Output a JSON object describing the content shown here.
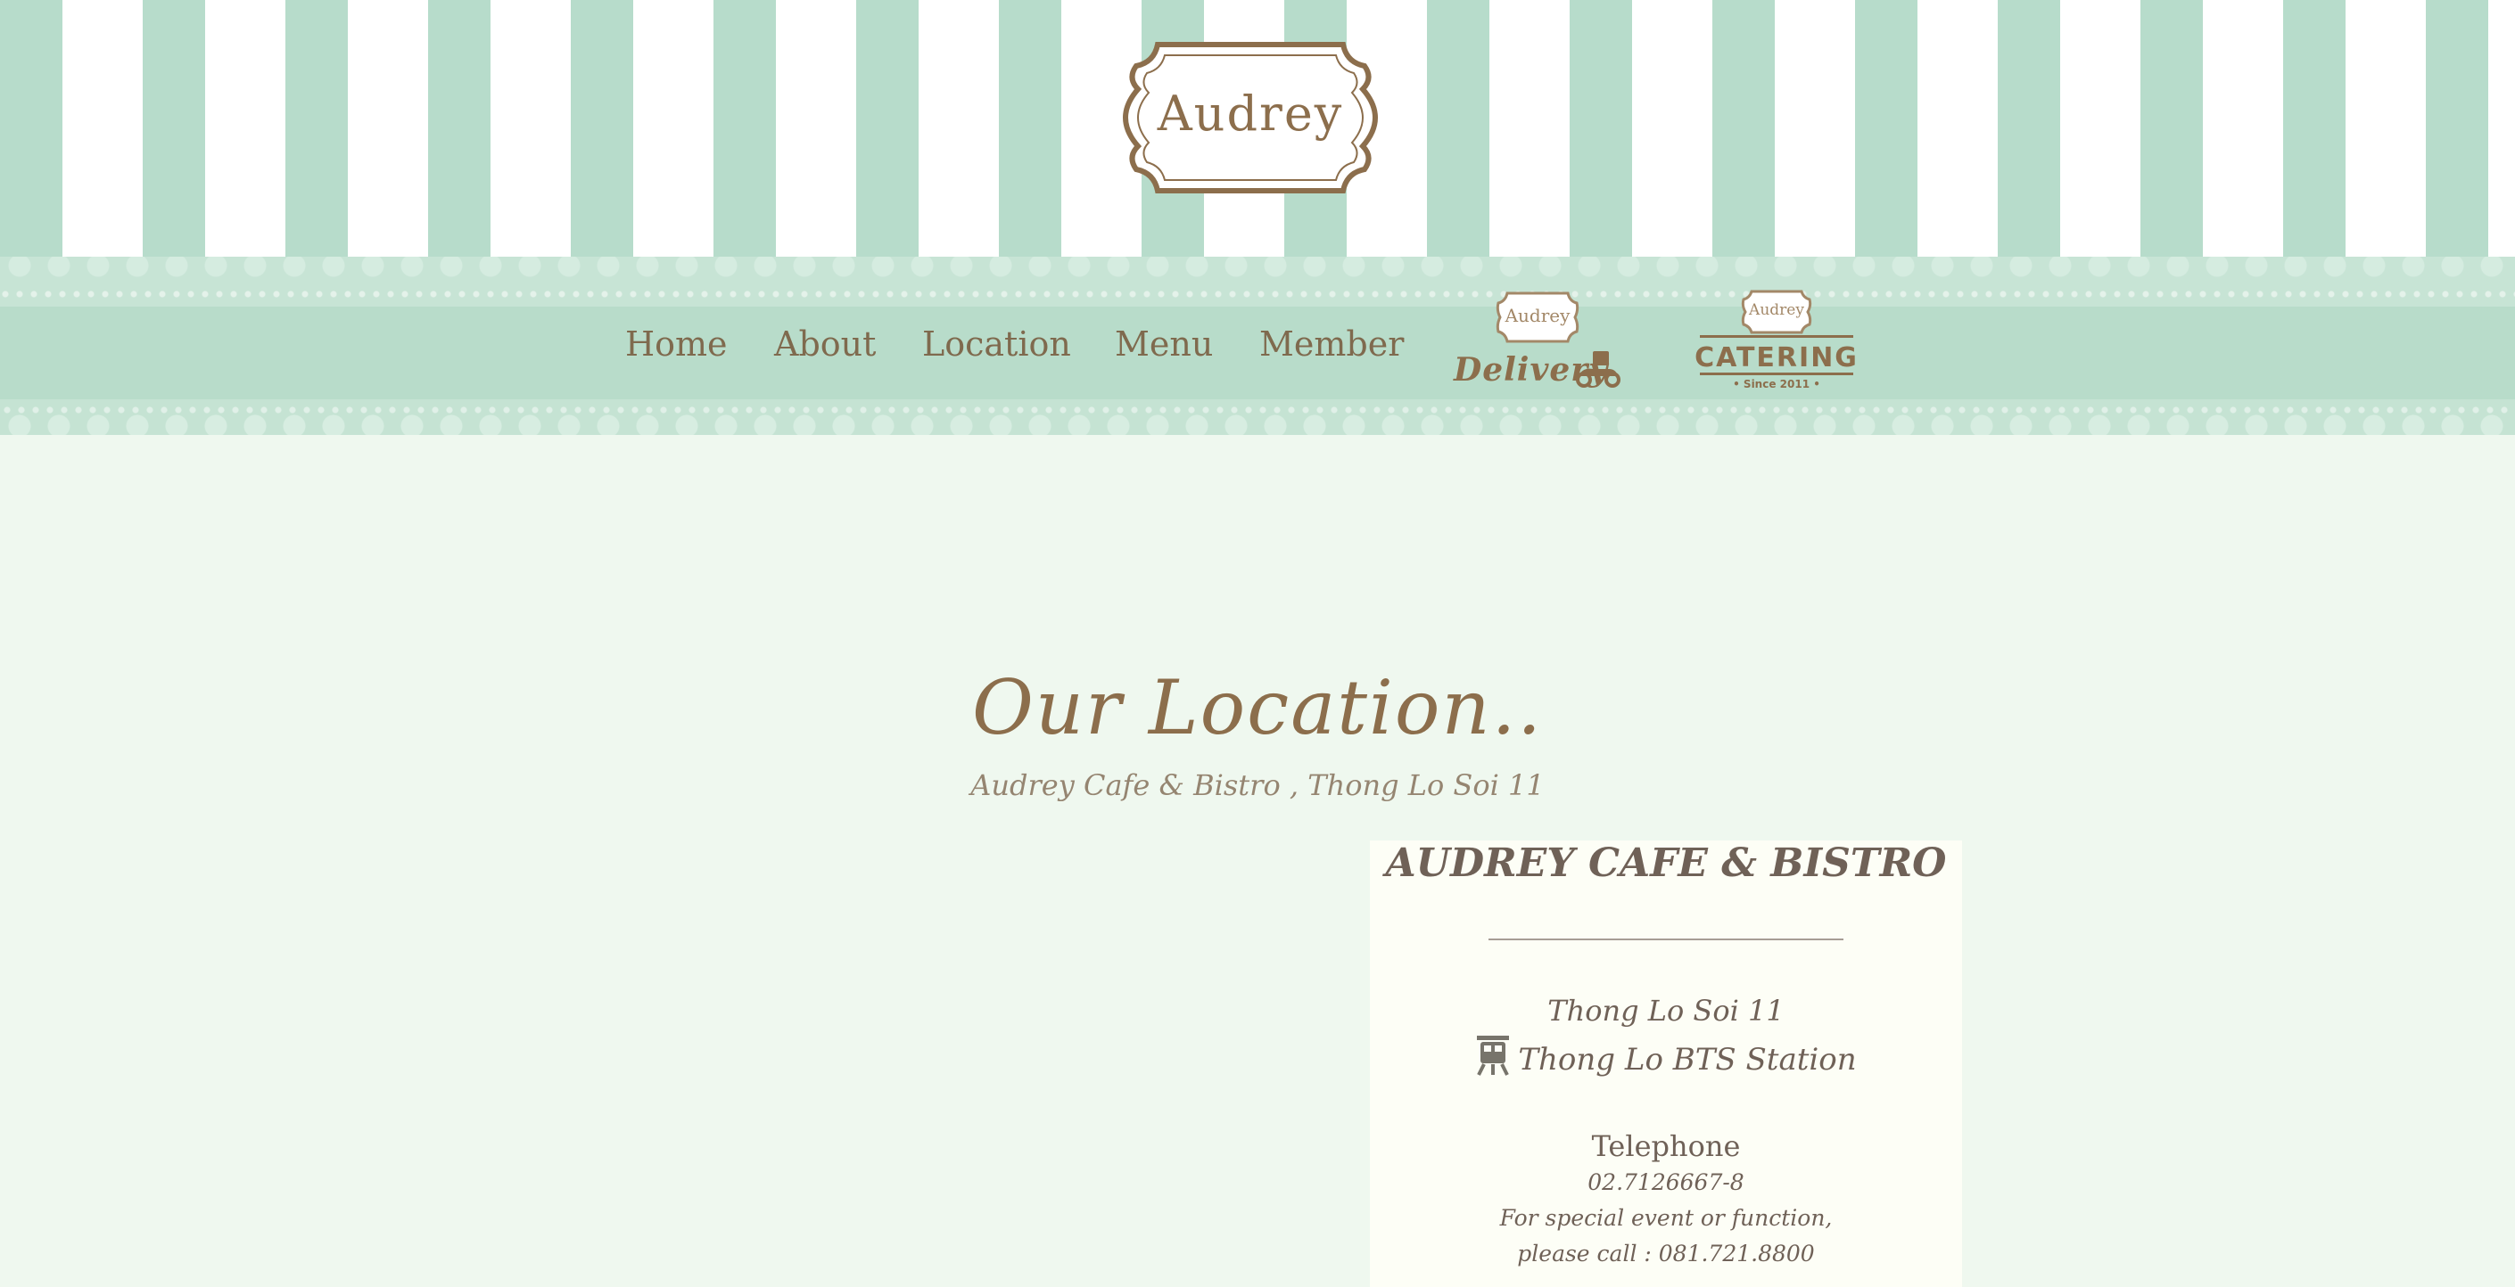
{
  "header": {
    "logo_text": "Audrey"
  },
  "nav": {
    "items": [
      {
        "label": "Home"
      },
      {
        "label": "About"
      },
      {
        "label": "Location"
      },
      {
        "label": "Menu"
      },
      {
        "label": "Member"
      }
    ],
    "delivery_badge": {
      "mini_logo": "Audrey",
      "label": "Delivery",
      "icon": "scooter-icon"
    },
    "catering_badge": {
      "mini_logo": "Audrey",
      "label": "CATERING",
      "since": "• Since 2011 •"
    }
  },
  "main": {
    "title": "Our Location..",
    "subtitle": "Audrey Cafe & Bistro , Thong Lo Soi 11",
    "card": {
      "title": "AUDREY CAFE & BISTRO",
      "street": "Thong Lo Soi 11",
      "bts": "Thong Lo BTS Station",
      "bts_icon": "train-icon",
      "tel_label": "Telephone",
      "tel_number": "02.7126667-8",
      "special_line1": "For special event or function,",
      "special_line2": "please call : 081.721.8800"
    }
  },
  "colors": {
    "stripe_green": "#b7dccb",
    "page_background": "#eff8ef",
    "brand_brown": "#8c6e4c",
    "card_background": "#fdfef6",
    "card_text": "#6f6157"
  }
}
